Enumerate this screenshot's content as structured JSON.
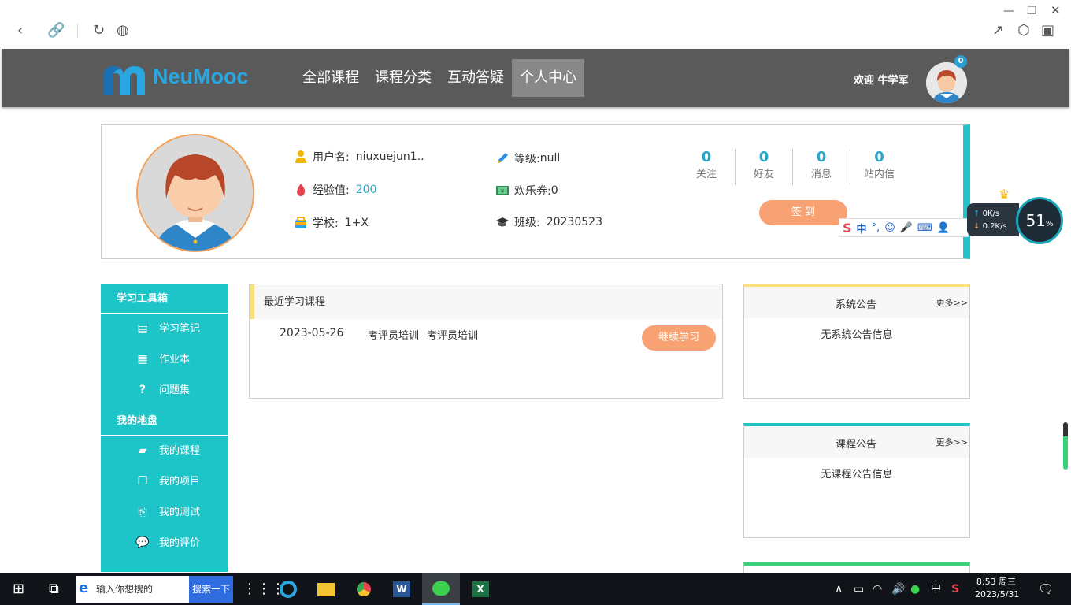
{
  "site": {
    "logo_text": "NeuMooc",
    "nav": [
      {
        "label": "全部课程"
      },
      {
        "label": "课程分类"
      },
      {
        "label": "互动答疑"
      },
      {
        "label": "个人中心"
      }
    ],
    "welcome": "欢迎 牛学军",
    "notification_count": "0"
  },
  "profile": {
    "username_label": "用户名:",
    "username": "niuxuejun1..",
    "level_label": "等级:",
    "level": "null",
    "exp_label": "经验值:",
    "exp": "200",
    "coupon_label": "欢乐券:",
    "coupon": "0",
    "school_label": "学校:",
    "school": "1+X",
    "class_label": "班级:",
    "class": "20230523",
    "stats": [
      {
        "num": "0",
        "label": "关注"
      },
      {
        "num": "0",
        "label": "好友"
      },
      {
        "num": "0",
        "label": "消息"
      },
      {
        "num": "0",
        "label": "站内信"
      }
    ],
    "signin_label": "签 到"
  },
  "sidebar": {
    "groups": [
      {
        "title": "学习工具箱",
        "items": [
          {
            "label": "学习笔记",
            "icon": "notes-icon"
          },
          {
            "label": "作业本",
            "icon": "homework-icon"
          },
          {
            "label": "问题集",
            "icon": "question-icon"
          }
        ]
      },
      {
        "title": "我的地盘",
        "items": [
          {
            "label": "我的课程",
            "icon": "book-icon"
          },
          {
            "label": "我的项目",
            "icon": "project-icon"
          },
          {
            "label": "我的测试",
            "icon": "test-icon"
          },
          {
            "label": "我的评价",
            "icon": "comment-icon"
          }
        ]
      }
    ]
  },
  "recent": {
    "title": "最近学习课程",
    "date": "2023-05-26",
    "course1": "考评员培训",
    "course2": "考评员培训",
    "continue_label": "继续学习"
  },
  "notices": {
    "system": {
      "title": "系统公告",
      "more": "更多>>",
      "empty": "无系统公告信息"
    },
    "course": {
      "title": "课程公告",
      "more": "更多>>",
      "empty": "无课程公告信息"
    }
  },
  "widgets": {
    "ime_lang": "中",
    "upload_speed": "0K/s",
    "download_speed": "0.2K/s",
    "memory_percent": "51",
    "percent_sign": "%"
  },
  "taskbar": {
    "search_placeholder": "输入你想搜的",
    "search_button": "搜索一下",
    "tray_lang": "中",
    "time": "8:53 周三",
    "date": "2023/5/31"
  },
  "colors": {
    "teal": "#1dc4c8",
    "orange": "#f8a173",
    "header": "#5a5a5a",
    "link_blue": "#2aa7c7"
  }
}
